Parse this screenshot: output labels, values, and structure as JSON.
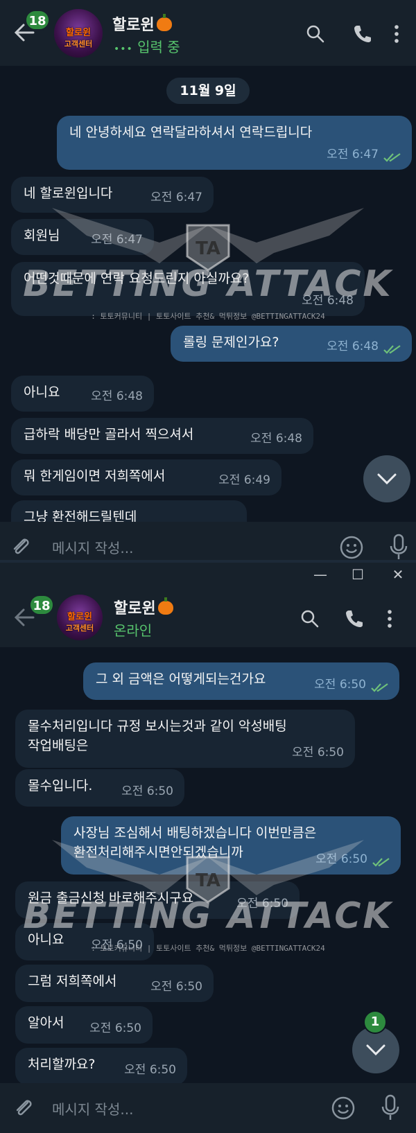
{
  "colors": {
    "bg": "#0e1621",
    "header": "#17212b",
    "incoming": "#182533",
    "outgoing": "#2b5278",
    "online_green": "#57c46d",
    "badge_green": "#2d8a3e"
  },
  "top": {
    "unread_badge": "18",
    "avatar_text_line1": "할로윈",
    "avatar_text_line2": "고객센터",
    "contact_name": "할로윈",
    "status": "입력 중",
    "date_divider": "11월 9일",
    "messages": [
      {
        "dir": "out",
        "text": "네 안녕하세요 연락달라하셔서 연락드립니다",
        "time": "오전 6:47"
      },
      {
        "dir": "in",
        "text": "네 할로윈입니다",
        "time": "오전 6:47"
      },
      {
        "dir": "in",
        "text": "회원님",
        "time": "오전 6:47"
      },
      {
        "dir": "in",
        "text": "어떤것때문에 연락 요청드린지 아실까요?",
        "time": "오전 6:48"
      },
      {
        "dir": "out",
        "text": "롤링 문제인가요?",
        "time": "오전 6:48"
      },
      {
        "dir": "in",
        "text": "아니요",
        "time": "오전 6:48"
      },
      {
        "dir": "in",
        "text": "급하락 배당만 골라서 찍으셔서",
        "time": "오전 6:48"
      },
      {
        "dir": "in",
        "text": "뭐 한게임이면 저희쪽에서",
        "time": "오전 6:49"
      },
      {
        "dir": "in",
        "text": "그냥 환전해드릴텐데",
        "time": ""
      }
    ],
    "input_placeholder": "메시지 작성..."
  },
  "bottom": {
    "window_buttons": [
      "—",
      "☐",
      "✕"
    ],
    "unread_badge": "18",
    "avatar_text_line1": "할로윈",
    "avatar_text_line2": "고객센터",
    "contact_name": "할로윈",
    "status": "온라인",
    "messages": [
      {
        "dir": "out",
        "text": "그 외 금액은 어떻게되는건가요",
        "time": "오전 6:50"
      },
      {
        "dir": "in",
        "line1": "몰수처리입니다 규정 보시는것과 같이 악성배팅",
        "line2": "작업배팅은",
        "time": "오전 6:50"
      },
      {
        "dir": "in",
        "text": "몰수입니다.",
        "time": "오전 6:50"
      },
      {
        "dir": "out",
        "line1": "사장님 조심해서 배팅하겠습니다 이번만큼은",
        "line2": "환전처리해주시면안되겠습니까",
        "time": "오전 6:50"
      },
      {
        "dir": "in",
        "text": "원금 출금신청 바로해주시구요",
        "time": "오전 6:50"
      },
      {
        "dir": "in",
        "text": "아니요",
        "time": "오전 6:50"
      },
      {
        "dir": "in",
        "text": "그럼 저희쪽에서",
        "time": "오전 6:50"
      },
      {
        "dir": "in",
        "text": "알아서",
        "time": "오전 6:50"
      },
      {
        "dir": "in",
        "text": "처리할까요?",
        "time": "오전 6:50"
      }
    ],
    "scroll_badge": "1",
    "input_placeholder": "메시지 작성..."
  },
  "watermark": {
    "logo": "TA",
    "title": "BETTING ATTACK",
    "subtitle": ": 토토커뮤니티 | 토토사이트 추천& 먹튀정보 @BETTINGATTACK24"
  },
  "icons": [
    "back-arrow-icon",
    "search-icon",
    "phone-icon",
    "more-vertical-icon",
    "attach-icon",
    "emoji-icon",
    "mic-icon",
    "chevron-down-icon",
    "double-check-icon",
    "pumpkin-icon"
  ]
}
